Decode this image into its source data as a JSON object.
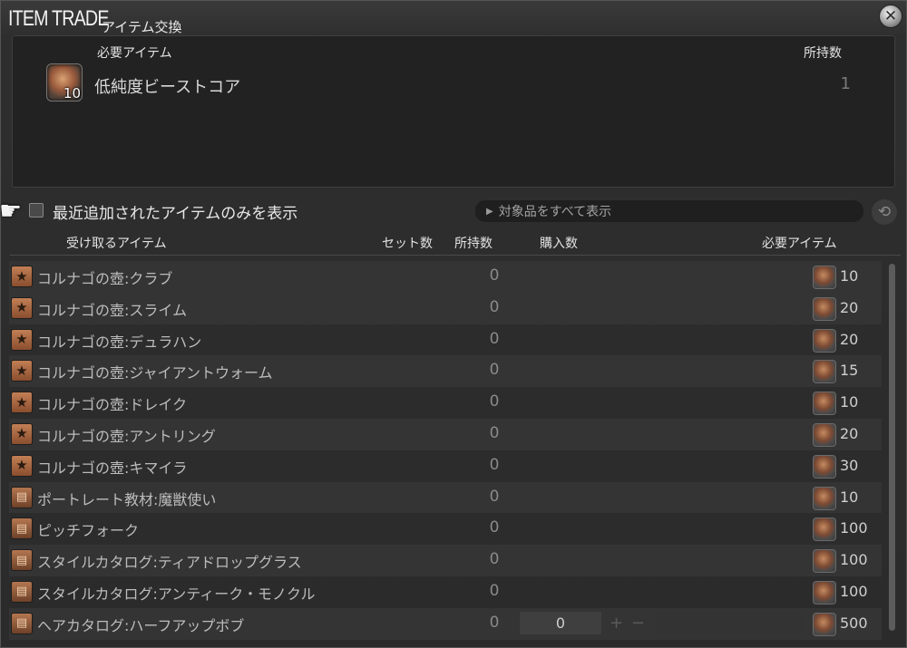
{
  "window": {
    "title_en": "ITEM TRADE",
    "title_ja": "アイテム交換"
  },
  "required_panel": {
    "header_item": "必要アイテム",
    "header_owned": "所持数",
    "item_name": "低純度ビーストコア",
    "icon_count": "10",
    "owned": "1"
  },
  "filter": {
    "checkbox_label": "最近追加されたアイテムのみを表示",
    "dropdown_value": "対象品をすべて表示"
  },
  "table": {
    "headers": {
      "receive": "受け取るアイテム",
      "set_count": "セット数",
      "owned": "所持数",
      "purchase_qty": "購入数",
      "required": "必要アイテム"
    },
    "rows": [
      {
        "icon": "star-icon",
        "name": "コルナゴの壺:クラブ",
        "owned": "0",
        "cost": "10"
      },
      {
        "icon": "star-icon",
        "name": "コルナゴの壺:スライム",
        "owned": "0",
        "cost": "20"
      },
      {
        "icon": "star-icon",
        "name": "コルナゴの壺:デュラハン",
        "owned": "0",
        "cost": "20"
      },
      {
        "icon": "star-icon",
        "name": "コルナゴの壺:ジャイアントウォーム",
        "owned": "0",
        "cost": "15"
      },
      {
        "icon": "star-icon",
        "name": "コルナゴの壺:ドレイク",
        "owned": "0",
        "cost": "10"
      },
      {
        "icon": "star-icon",
        "name": "コルナゴの壺:アントリング",
        "owned": "0",
        "cost": "20"
      },
      {
        "icon": "star-icon",
        "name": "コルナゴの壺:キマイラ",
        "owned": "0",
        "cost": "30"
      },
      {
        "icon": "book-icon",
        "name": "ポートレート教材:魔獣使い",
        "owned": "0",
        "cost": "10"
      },
      {
        "icon": "book-icon",
        "name": "ピッチフォーク",
        "owned": "0",
        "cost": "100"
      },
      {
        "icon": "book-icon",
        "name": "スタイルカタログ:ティアドロップグラス",
        "owned": "0",
        "cost": "100"
      },
      {
        "icon": "book-icon",
        "name": "スタイルカタログ:アンティーク・モノクル",
        "owned": "0",
        "cost": "100"
      },
      {
        "icon": "book-icon",
        "name": "ヘアカタログ:ハーフアップボブ",
        "owned": "0",
        "cost": "500",
        "qty": "0"
      }
    ]
  }
}
